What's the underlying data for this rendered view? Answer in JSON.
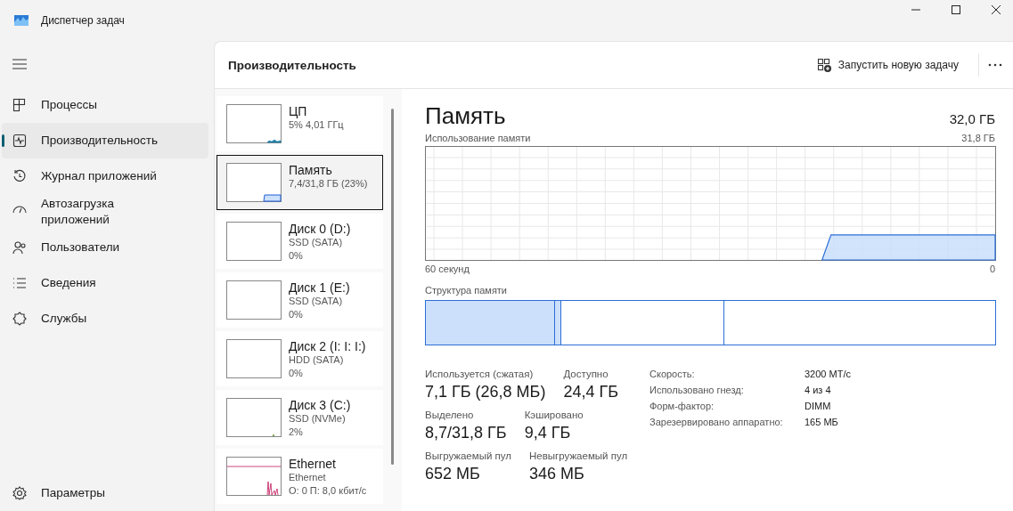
{
  "window": {
    "title": "Диспетчер задач"
  },
  "sidebar": {
    "items": [
      {
        "kind": "processes",
        "label": "Процессы",
        "selected": false
      },
      {
        "kind": "performance",
        "label": "Производительность",
        "selected": true
      },
      {
        "kind": "history",
        "label": "Журнал приложений",
        "selected": false
      },
      {
        "kind": "startup",
        "label": "Автозагрузка приложений",
        "selected": false
      },
      {
        "kind": "users",
        "label": "Пользователи",
        "selected": false
      },
      {
        "kind": "details",
        "label": "Сведения",
        "selected": false
      },
      {
        "kind": "services",
        "label": "Службы",
        "selected": false
      }
    ],
    "footer": {
      "label": "Параметры"
    }
  },
  "header": {
    "title": "Производительность",
    "action": "Запустить новую задачу"
  },
  "devices": [
    {
      "kind": "cpu",
      "name": "ЦП",
      "lines": [
        "5% 4,01 ГГц"
      ],
      "selected": false
    },
    {
      "kind": "memory",
      "name": "Память",
      "lines": [
        "7,4/31,8 ГБ (23%)"
      ],
      "selected": true
    },
    {
      "kind": "disk",
      "name": "Диск 0 (D:)",
      "lines": [
        "SSD (SATA)",
        "0%"
      ],
      "selected": false
    },
    {
      "kind": "disk",
      "name": "Диск 1 (E:)",
      "lines": [
        "SSD (SATA)",
        "0%"
      ],
      "selected": false
    },
    {
      "kind": "disk",
      "name": "Диск 2 (I: I: I:)",
      "lines": [
        "HDD (SATA)",
        "0%"
      ],
      "selected": false
    },
    {
      "kind": "disk-active",
      "name": "Диск 3 (C:)",
      "lines": [
        "SSD (NVMe)",
        "2%"
      ],
      "selected": false
    },
    {
      "kind": "network",
      "name": "Ethernet",
      "lines": [
        "Ethernet",
        "О: 0 П: 8,0 кбит/с"
      ],
      "selected": false
    }
  ],
  "detail": {
    "title": "Память",
    "total": "32,0 ГБ",
    "usage_label": "Использование памяти",
    "usage_max": "31,8 ГБ",
    "time_start": "60 секунд",
    "time_end": "0",
    "composition_label": "Структура памяти",
    "composition": [
      {
        "kind": "used",
        "level": 0.227
      },
      {
        "kind": "modified",
        "level": 0.009
      },
      {
        "kind": "standby",
        "level": 0.286
      },
      {
        "kind": "free",
        "level": 0.478
      }
    ],
    "stat_rows": [
      [
        {
          "label": "Используется (сжатая)",
          "value": "7,1 ГБ (26,8 МБ)"
        },
        {
          "label": "Доступно",
          "value": "24,4 ГБ"
        }
      ],
      [
        {
          "label": "Выделено",
          "value": "8,7/31,8 ГБ"
        },
        {
          "label": "Кэшировано",
          "value": "9,4 ГБ"
        }
      ],
      [
        {
          "label": "Выгружаемый пул",
          "value": "652 МБ"
        },
        {
          "label": "Невыгружаемый пул",
          "value": "346 МБ"
        }
      ]
    ],
    "specs": [
      {
        "label": "Скорость:",
        "value": "3200 МТ/с"
      },
      {
        "label": "Использовано гнезд:",
        "value": "4 из 4"
      },
      {
        "label": "Форм-фактор:",
        "value": "DIMM"
      },
      {
        "label": "Зарезервировано аппаратно:",
        "value": "165 МБ"
      }
    ]
  }
}
